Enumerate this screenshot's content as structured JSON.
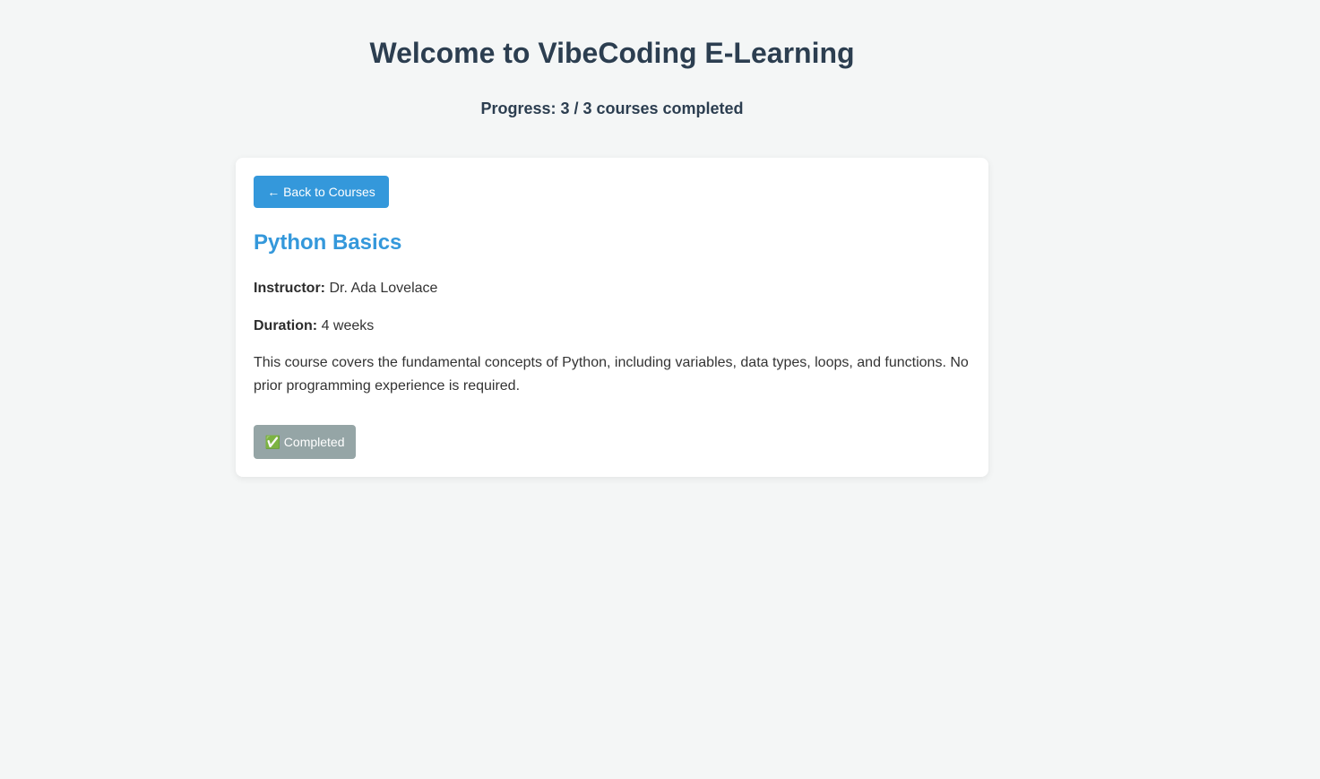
{
  "header": {
    "title": "Welcome to VibeCoding E-Learning",
    "progress": "Progress: 3 / 3 courses completed"
  },
  "course": {
    "back_label": "← Back to Courses",
    "title": "Python Basics",
    "instructor_label": "Instructor:",
    "instructor": "Dr. Ada Lovelace",
    "duration_label": "Duration:",
    "duration": "4 weeks",
    "description": "This course covers the fundamental concepts of Python, including variables, data types, loops, and functions. No prior programming experience is required.",
    "status_label": "✅ Completed"
  },
  "colors": {
    "accent": "#3498db",
    "completed": "#95a5a6",
    "text": "#2c3e50",
    "background": "#f4f6f6"
  }
}
